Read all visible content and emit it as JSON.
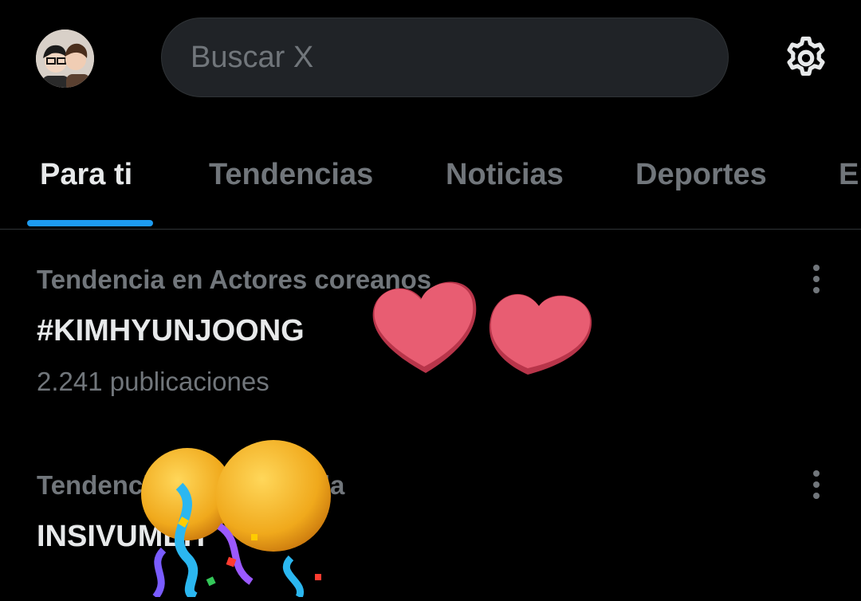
{
  "header": {
    "avatar_icon": "user-avatar-icon",
    "search": {
      "placeholder": "Buscar X",
      "value": ""
    },
    "settings_icon": "gear-icon"
  },
  "tabs": [
    {
      "label": "Para ti",
      "active": true
    },
    {
      "label": "Tendencias",
      "active": false
    },
    {
      "label": "Noticias",
      "active": false
    },
    {
      "label": "Deportes",
      "active": false
    },
    {
      "label": "En",
      "active": false
    }
  ],
  "trends": [
    {
      "context": "Tendencia en Actores coreanos",
      "name": "#KIMHYUNJOONG",
      "count": "2.241 publicaciones"
    },
    {
      "context": "Tendencia en Guatemala",
      "name": "INSIVUMEH",
      "count": ""
    }
  ],
  "stickers": [
    "hearts-sticker",
    "confetti-egg-sticker"
  ],
  "colors": {
    "accent": "#1d9bf0",
    "muted": "#71767b",
    "text": "#e7e9ea",
    "background": "#000000"
  }
}
